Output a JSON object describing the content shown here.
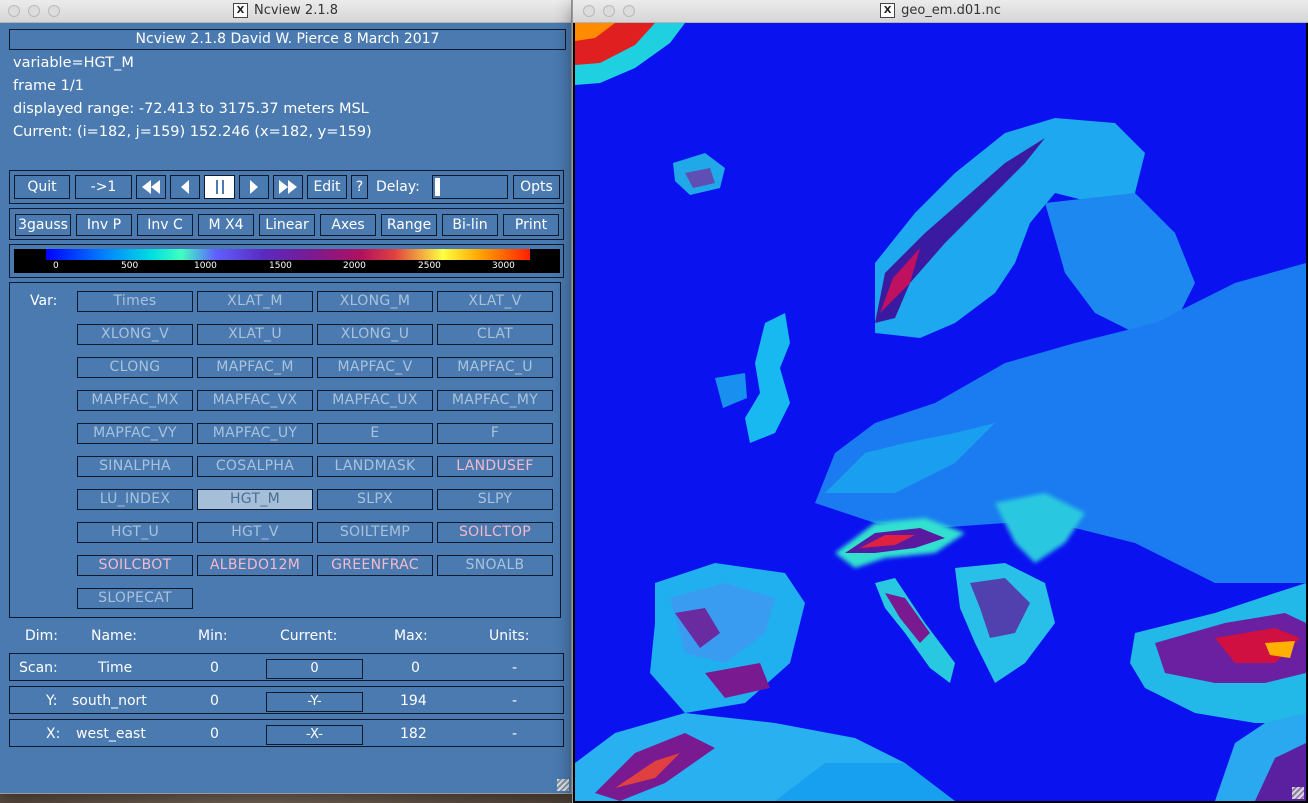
{
  "ncview": {
    "title": "Ncview 2.1.8",
    "header": "Ncview 2.1.8 David W. Pierce  8 March 2017",
    "variable": "variable=HGT_M",
    "frame": "frame 1/1",
    "range": "displayed range: -72.413 to 3175.37 meters MSL",
    "current": "Current: (i=182, j=159) 152.246 (x=182, y=159)",
    "controls": {
      "quit": "Quit",
      "reset": "->1",
      "edit": "Edit",
      "help": "?",
      "delay": "Delay:",
      "opts": "Opts"
    },
    "options": [
      "3gauss",
      "Inv P",
      "Inv C",
      "M X4",
      "Linear",
      "Axes",
      "Range",
      "Bi-lin",
      "Print"
    ],
    "colorbar_ticks": [
      "0",
      "500",
      "1000",
      "1500",
      "2000",
      "2500",
      "3000"
    ],
    "var_label": "Var:",
    "variables": [
      {
        "name": "Times",
        "state": "dim"
      },
      {
        "name": "XLAT_M",
        "state": "dim"
      },
      {
        "name": "XLONG_M",
        "state": "dim"
      },
      {
        "name": "XLAT_V",
        "state": "dim"
      },
      {
        "name": "XLONG_V",
        "state": "dim"
      },
      {
        "name": "XLAT_U",
        "state": "dim"
      },
      {
        "name": "XLONG_U",
        "state": "dim"
      },
      {
        "name": "CLAT",
        "state": "dim"
      },
      {
        "name": "CLONG",
        "state": "dim"
      },
      {
        "name": "MAPFAC_M",
        "state": "dim"
      },
      {
        "name": "MAPFAC_V",
        "state": "dim"
      },
      {
        "name": "MAPFAC_U",
        "state": "dim"
      },
      {
        "name": "MAPFAC_MX",
        "state": "dim"
      },
      {
        "name": "MAPFAC_VX",
        "state": "dim"
      },
      {
        "name": "MAPFAC_UX",
        "state": "dim"
      },
      {
        "name": "MAPFAC_MY",
        "state": "dim"
      },
      {
        "name": "MAPFAC_VY",
        "state": "dim"
      },
      {
        "name": "MAPFAC_UY",
        "state": "dim"
      },
      {
        "name": "E",
        "state": "dim"
      },
      {
        "name": "F",
        "state": "dim"
      },
      {
        "name": "SINALPHA",
        "state": "dim"
      },
      {
        "name": "COSALPHA",
        "state": "dim"
      },
      {
        "name": "LANDMASK",
        "state": "dim"
      },
      {
        "name": "LANDUSEF",
        "state": "pink"
      },
      {
        "name": "LU_INDEX",
        "state": "dim"
      },
      {
        "name": "HGT_M",
        "state": "selected"
      },
      {
        "name": "SLPX",
        "state": "dim"
      },
      {
        "name": "SLPY",
        "state": "dim"
      },
      {
        "name": "HGT_U",
        "state": "dim"
      },
      {
        "name": "HGT_V",
        "state": "dim"
      },
      {
        "name": "SOILTEMP",
        "state": "dim"
      },
      {
        "name": "SOILCTOP",
        "state": "pink"
      },
      {
        "name": "SOILCBOT",
        "state": "pink"
      },
      {
        "name": "ALBEDO12M",
        "state": "pink"
      },
      {
        "name": "GREENFRAC",
        "state": "pink"
      },
      {
        "name": "SNOALB",
        "state": "dim"
      },
      {
        "name": "SLOPECAT",
        "state": "dim"
      }
    ],
    "dim_headers": {
      "dim": "Dim:",
      "name": "Name:",
      "min": "Min:",
      "current": "Current:",
      "max": "Max:",
      "units": "Units:"
    },
    "dims": [
      {
        "dim": "Scan:",
        "name": "Time",
        "min": "0",
        "current": "0",
        "max": "0",
        "units": "-"
      },
      {
        "dim": "Y:",
        "name": "south_nort",
        "min": "0",
        "current": "-Y-",
        "max": "194",
        "units": "-"
      },
      {
        "dim": "X:",
        "name": "west_east",
        "min": "0",
        "current": "-X-",
        "max": "182",
        "units": "-"
      }
    ]
  },
  "map_window": {
    "title": "geo_em.d01.nc",
    "x_logo": "X"
  },
  "colors": {
    "panel_bg": "#4a7ab0",
    "map_ocean": "#0a12f0",
    "var_dim": "#a9c2dc",
    "var_pink": "#f3b9cc",
    "var_selected_bg": "#a5bfd8"
  }
}
